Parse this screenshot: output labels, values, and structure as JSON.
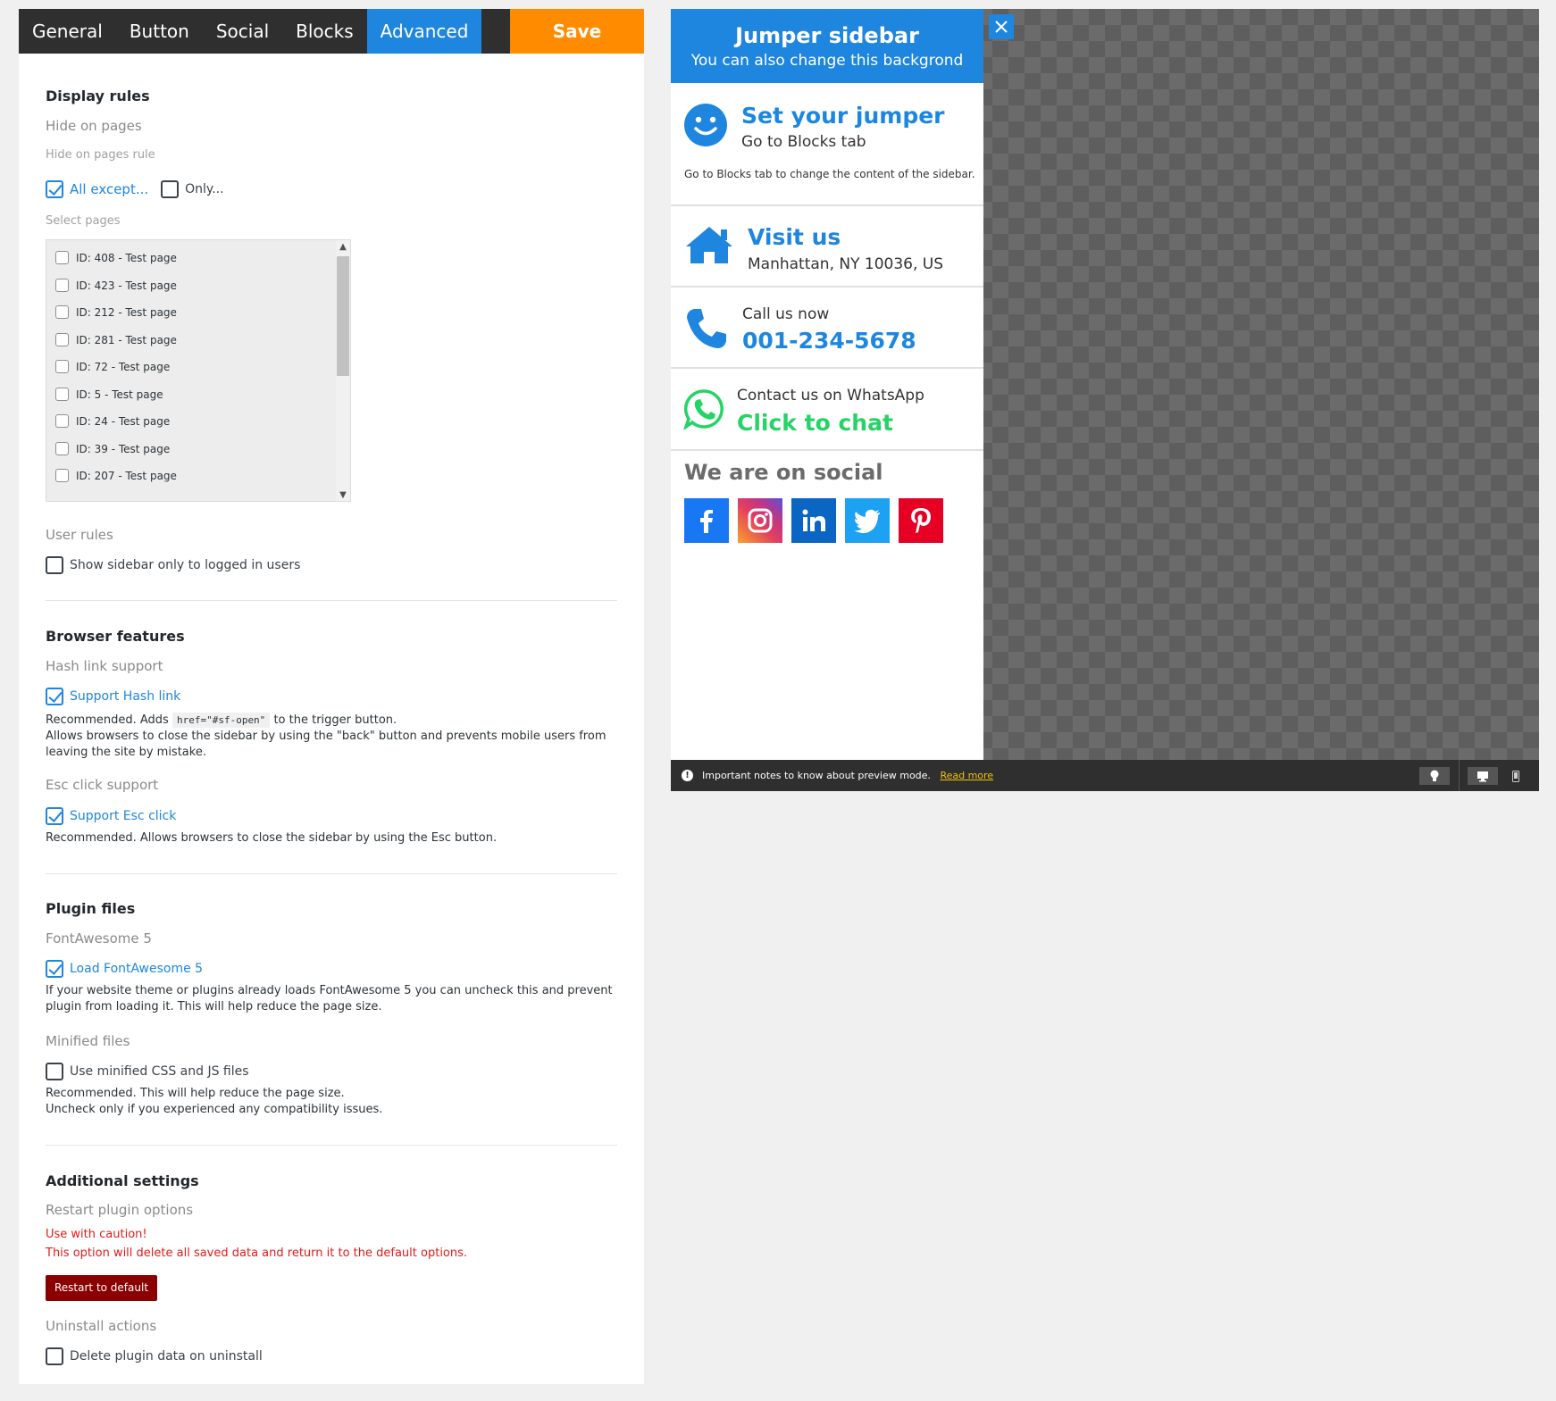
{
  "tabs": [
    {
      "label": "General"
    },
    {
      "label": "Button"
    },
    {
      "label": "Social"
    },
    {
      "label": "Blocks"
    },
    {
      "label": "Advanced"
    }
  ],
  "save_label": "Save",
  "display_rules": {
    "heading": "Display rules",
    "hide_on_pages": "Hide on pages",
    "hide_rule_label": "Hide on pages rule",
    "all_except": "All except...",
    "only": "Only...",
    "select_pages": "Select pages",
    "pages": [
      "ID: 408 - Test page",
      "ID: 423 - Test page",
      "ID: 212 - Test page",
      "ID: 281 - Test page",
      "ID: 72 - Test page",
      "ID: 5 - Test page",
      "ID: 24 - Test page",
      "ID: 39 - Test page",
      "ID: 207 - Test page"
    ],
    "user_rules": "User rules",
    "logged_in_only": "Show sidebar only to logged in users"
  },
  "browser_features": {
    "heading": "Browser features",
    "hash_support": "Hash link support",
    "hash_checkbox": "Support Hash link",
    "hash_desc_pre": "Recommended. Adds",
    "hash_code": "href=\"#sf-open\"",
    "hash_desc_post": "to the trigger button.",
    "hash_desc_2": "Allows browsers to close the sidebar by using the \"back\" button and prevents mobile users from leaving the site by mistake.",
    "esc_support": "Esc click support",
    "esc_checkbox": "Support Esc click",
    "esc_desc": "Recommended. Allows browsers to close the sidebar by using the Esc button."
  },
  "plugin_files": {
    "heading": "Plugin files",
    "fontawesome": "FontAwesome 5",
    "fa_checkbox": "Load FontAwesome 5",
    "fa_desc": "If your website theme or plugins already loads FontAwesome 5 you can uncheck this and prevent plugin from loading it. This will help reduce the page size.",
    "minified": "Minified files",
    "min_checkbox": "Use minified CSS and JS files",
    "min_desc_1": "Recommended. This will help reduce the page size.",
    "min_desc_2": "Uncheck only if you experienced any compatibility issues."
  },
  "additional": {
    "heading": "Additional settings",
    "restart_options": "Restart plugin options",
    "caution_1": "Use with caution!",
    "caution_2": "This option will delete all saved data and return it to the default options.",
    "restart_button": "Restart to default",
    "uninstall": "Uninstall actions",
    "uninstall_checkbox": "Delete plugin data on uninstall"
  },
  "sidebar": {
    "title": "Jumper sidebar",
    "subtitle": "You can also change this backgrond",
    "block1_title": "Set your jumper",
    "block1_sub": "Go to Blocks tab",
    "block1_desc": "Go to Blocks tab to change the content of the sidebar.",
    "block2_title": "Visit us",
    "block2_sub": "Manhattan, NY 10036, US",
    "block3_label": "Call us now",
    "block3_phone": "001-234-5678",
    "block4_label": "Contact us on WhatsApp",
    "block4_cta": "Click to chat",
    "social_heading": "We are on social"
  },
  "preview_footer": {
    "notice": "Important notes to know about preview mode.",
    "read_more": "Read more"
  },
  "colors": {
    "accent": "#1e86de",
    "save": "#ff8c00",
    "danger": "#8b0000",
    "whatsapp": "#25d366"
  }
}
